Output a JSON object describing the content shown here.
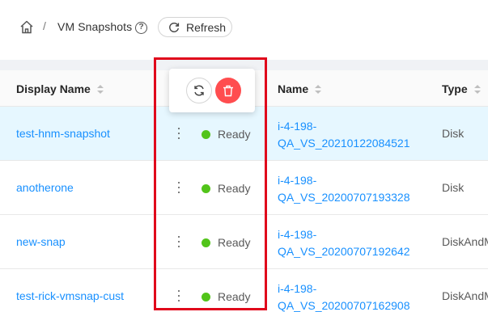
{
  "breadcrumb": {
    "separator": "/",
    "title": "VM Snapshots",
    "help": "?",
    "refresh_label": "Refresh"
  },
  "table": {
    "columns": [
      "Display Name",
      "Name",
      "Type"
    ],
    "rows": [
      {
        "display_name": "test-hnm-snapshot",
        "status": "Ready",
        "name_line1": "i-4-198-",
        "name_line2": "QA_VS_20210122084521",
        "type": "Disk"
      },
      {
        "display_name": "anotherone",
        "status": "Ready",
        "name_line1": "i-4-198-",
        "name_line2": "QA_VS_20200707193328",
        "type": "Disk"
      },
      {
        "display_name": "new-snap",
        "status": "Ready",
        "name_line1": "i-4-198-",
        "name_line2": "QA_VS_20200707192642",
        "type": "DiskAndM"
      },
      {
        "display_name": "test-rick-vmsnap-cust",
        "status": "Ready",
        "name_line1": "i-4-198-",
        "name_line2": "QA_VS_20200707162908",
        "type": "DiskAndM"
      }
    ]
  },
  "popover": {
    "actions": [
      "revert-snapshot",
      "delete-snapshot"
    ]
  },
  "colors": {
    "link": "#1890ff",
    "ready": "#52c41a",
    "danger": "#ff4d4f",
    "highlight_box": "#e0061b",
    "row_selected": "#e6f7ff"
  }
}
